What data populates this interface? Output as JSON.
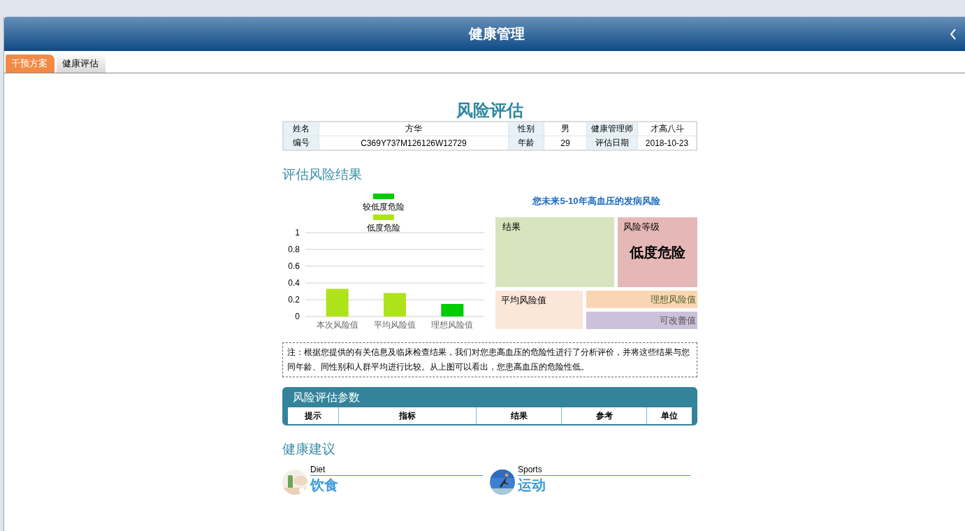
{
  "header": {
    "title": "健康管理"
  },
  "tabs": [
    {
      "label": "干预方案",
      "selected": true
    },
    {
      "label": "健康评估",
      "selected": false
    }
  ],
  "report": {
    "title": "风险评估",
    "info_rows": [
      [
        {
          "label": "姓名",
          "value": "方华"
        },
        {
          "label": "性别",
          "value": "男"
        },
        {
          "label": "健康管理师",
          "value": "才高八斗"
        }
      ],
      [
        {
          "label": "编号",
          "value": "C369Y737M126126W12729"
        },
        {
          "label": "年龄",
          "value": "29"
        },
        {
          "label": "评估日期",
          "value": "2018-10-23"
        }
      ]
    ]
  },
  "risk_section": {
    "heading": "评估风险结果",
    "chart_data": {
      "type": "bar",
      "categories": [
        "本次风险值",
        "平均风险值",
        "理想风险值"
      ],
      "grid": true,
      "legend": true,
      "ylim": [
        0,
        1
      ],
      "yticks": [
        0,
        0.2,
        0.4,
        0.6,
        0.8,
        1
      ],
      "series": [
        {
          "name": "较低度危险",
          "color": "#00cc00",
          "values": [
            null,
            null,
            0.15
          ]
        },
        {
          "name": "低度危险",
          "color": "#aee31b",
          "values": [
            0.33,
            0.28,
            null
          ]
        }
      ]
    },
    "summary": {
      "title": "您未来**5-10**年高血压的发病风险",
      "tiles": [
        {
          "kind": "result",
          "label": "结果"
        },
        {
          "kind": "level",
          "label": "风险等级",
          "value": "低度危险"
        },
        {
          "kind": "average",
          "label": "平均风险值"
        },
        {
          "kind": "ideal",
          "label": "理想风险值"
        },
        {
          "kind": "improvable",
          "label": "可改善值"
        }
      ]
    },
    "note": "注：根据您提供的有关信息及临床检查结果，我们对您患高血压的危险性进行了分析评价，并将这些结果与您同年龄、同性别和人群平均进行比较。从上图可以看出，您患高血压的危险性低。"
  },
  "params": {
    "title": "风险评估参数",
    "columns": [
      "提示",
      "指标",
      "结果",
      "参考",
      "单位"
    ]
  },
  "advice": {
    "heading": "健康建议",
    "items": [
      {
        "label": "Diet",
        "title": "饮食"
      },
      {
        "label": "Sports",
        "title": "运动"
      }
    ]
  }
}
